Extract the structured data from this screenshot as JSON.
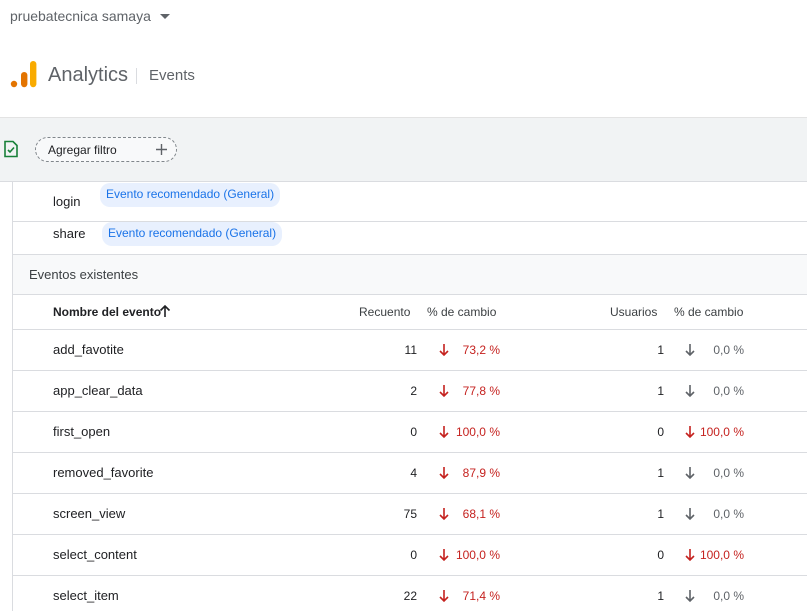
{
  "account": {
    "name": "pruebatecnica samaya"
  },
  "brand": {
    "app_name": "Analytics",
    "page_name": "Events"
  },
  "filter": {
    "add_label": "Agregar filtro"
  },
  "recommended_rows": [
    {
      "name": "login",
      "chip": "Evento recomendado (General)"
    },
    {
      "name": "share",
      "chip": "Evento recomendado (General)"
    }
  ],
  "section": {
    "title": "Eventos existentes"
  },
  "columns": {
    "event_name": "Nombre del evento",
    "count": "Recuento",
    "count_change": "% de cambio",
    "users": "Usuarios",
    "users_change": "% de cambio"
  },
  "rows": [
    {
      "name": "add_favotite",
      "count": "11",
      "count_change": "73,2 %",
      "users": "1",
      "users_change": "0,0 %"
    },
    {
      "name": "app_clear_data",
      "count": "2",
      "count_change": "77,8 %",
      "users": "1",
      "users_change": "0,0 %"
    },
    {
      "name": "first_open",
      "count": "0",
      "count_change": "100,0 %",
      "users": "0",
      "users_change": "100,0 %"
    },
    {
      "name": "removed_favorite",
      "count": "4",
      "count_change": "87,9 %",
      "users": "1",
      "users_change": "0,0 %"
    },
    {
      "name": "screen_view",
      "count": "75",
      "count_change": "68,1 %",
      "users": "1",
      "users_change": "0,0 %"
    },
    {
      "name": "select_content",
      "count": "0",
      "count_change": "100,0 %",
      "users": "0",
      "users_change": "100,0 %"
    },
    {
      "name": "select_item",
      "count": "22",
      "count_change": "71,4 %",
      "users": "1",
      "users_change": "0,0 %"
    }
  ],
  "colors": {
    "negative": "#c5221f",
    "neutral": "#5f6368",
    "chip_bg": "#e8f0fe",
    "chip_text": "#1a73e8"
  },
  "icons": {
    "sort": "arrow-up-icon",
    "change_down": "arrow-down-icon",
    "add": "plus-icon",
    "caret": "caret-down-icon"
  }
}
